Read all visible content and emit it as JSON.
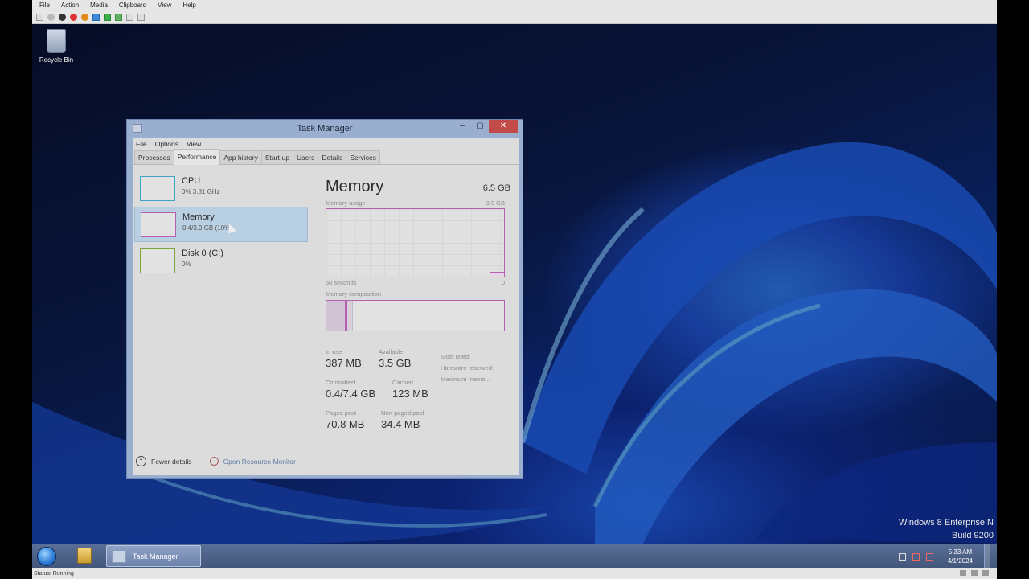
{
  "host": {
    "menu": [
      "File",
      "Action",
      "Media",
      "Clipboard",
      "View",
      "Help"
    ],
    "status": "Status: Running"
  },
  "desktop": {
    "recycle_bin_label": "Recycle Bin",
    "watermark_line1": "Windows 8 Enterprise N",
    "watermark_line2": "Build 9200"
  },
  "taskbar": {
    "task_label": "Task Manager",
    "time": "5:33 AM",
    "date": "4/1/2024"
  },
  "task_manager": {
    "title": "Task Manager",
    "controls": {
      "minimize": "–",
      "maximize": "▢",
      "close": "✕"
    },
    "menu": [
      "File",
      "Options",
      "View"
    ],
    "tabs": [
      "Processes",
      "Performance",
      "App history",
      "Start-up",
      "Users",
      "Details",
      "Services"
    ],
    "active_tab": "Performance",
    "side": [
      {
        "title": "CPU",
        "sub": "0% 3.81 GHz",
        "color": "#3fa6c6"
      },
      {
        "title": "Memory",
        "sub": "0.4/3.9 GB (10%)",
        "color": "#b55fb0"
      },
      {
        "title": "Disk 0 (C:)",
        "sub": "0%",
        "color": "#7fa23c"
      }
    ],
    "main": {
      "heading": "Memory",
      "total": "6.5 GB",
      "usage_label": "Memory usage",
      "usage_max": "3.9 GB",
      "axis_left": "60 seconds",
      "axis_right": "0",
      "composition_label": "Memory composition",
      "composition": {
        "in_use_fraction": 0.11,
        "modified_fraction": 0.005,
        "standby_fraction": 0.03
      },
      "stats": {
        "in_use_label": "In use",
        "in_use": "387 MB",
        "available_label": "Available",
        "available": "3.5 GB",
        "committed_label": "Committed",
        "committed": "0.4/7.4 GB",
        "cached_label": "Cached",
        "cached": "123 MB",
        "paged_label": "Paged pool",
        "paged": "70.8 MB",
        "nonpaged_label": "Non-paged pool",
        "nonpaged": "34.4 MB"
      },
      "right_labels": [
        "Slots used:",
        "Hardware reserved:",
        "Maximum memo..."
      ]
    },
    "footer": {
      "fewer_details": "Fewer details",
      "open_resmon": "Open Resource Monitor"
    }
  },
  "colors": {
    "memory_accent": "#b55fb0",
    "taskbar": "#4d6189",
    "close_button": "#c24b48"
  }
}
